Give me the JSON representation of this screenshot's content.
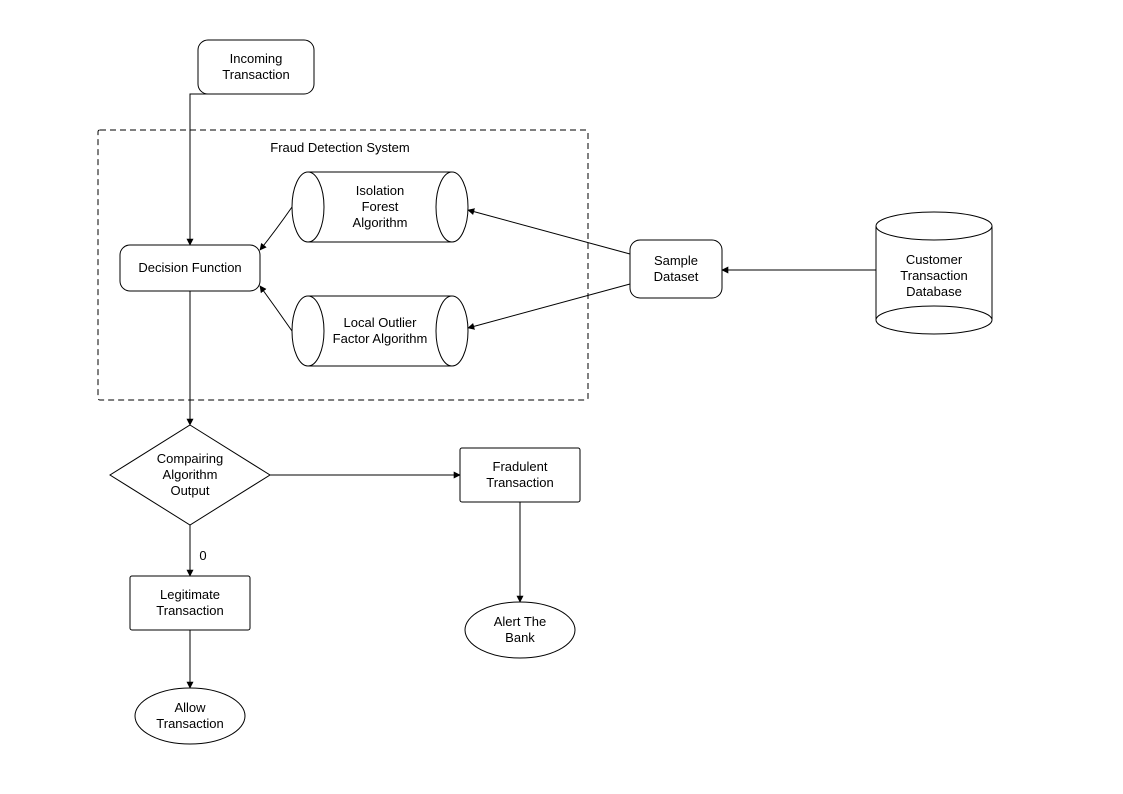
{
  "nodes": {
    "incoming": "Incoming\nTransaction",
    "system_title": "Fraud Detection System",
    "isolation": "Isolation\nForest\nAlgorithm",
    "decision_fn": "Decision Function",
    "lof": "Local Outlier\nFactor Algorithm",
    "sample": "Sample\nDataset",
    "db": "Customer\nTransaction\nDatabase",
    "compare": "Compairing\nAlgorithm\nOutput",
    "fraud": "Fradulent\nTransaction",
    "legit": "Legitimate\nTransaction",
    "alert": "Alert The\nBank",
    "allow": "Allow\nTransaction"
  },
  "edge_labels": {
    "compare_down": "0"
  },
  "colors": {
    "stroke": "#000000",
    "bg": "#ffffff"
  }
}
